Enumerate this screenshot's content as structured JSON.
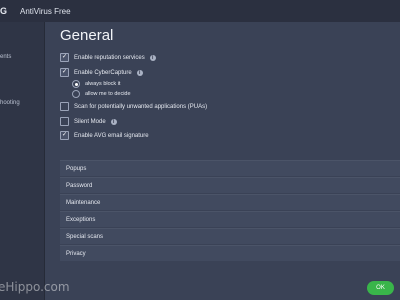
{
  "titlebar": {
    "logo_fragment": "G",
    "app_title": "AntiVirus Free"
  },
  "sidebar": {
    "items": [
      {
        "label": "ents"
      },
      {
        "label": "hooting"
      }
    ]
  },
  "main": {
    "title": "General",
    "options": [
      {
        "label": "Enable reputation services",
        "checked": true,
        "info": true
      },
      {
        "label": "Enable CyberCapture",
        "checked": true,
        "info": true
      },
      {
        "label": "Scan for potentially unwanted applications (PUAs)",
        "checked": false,
        "info": false
      },
      {
        "label": "Silent Mode",
        "checked": false,
        "info": true
      },
      {
        "label": "Enable AVG email signature",
        "checked": true,
        "info": false
      }
    ],
    "cybercapture_radios": [
      {
        "label": "always block it",
        "selected": true
      },
      {
        "label": "allow me to decide",
        "selected": false
      }
    ],
    "sections": [
      "Popups",
      "Password",
      "Maintenance",
      "Exceptions",
      "Special scans",
      "Privacy"
    ]
  },
  "footer": {
    "ok_label": "OK",
    "watermark": "eHippo.com"
  },
  "colors": {
    "accent_green": "#39b54a",
    "background": "#3a4256",
    "sidebar": "#2f3546"
  },
  "icons": {
    "checkbox_checked": "✓",
    "info": "i"
  }
}
